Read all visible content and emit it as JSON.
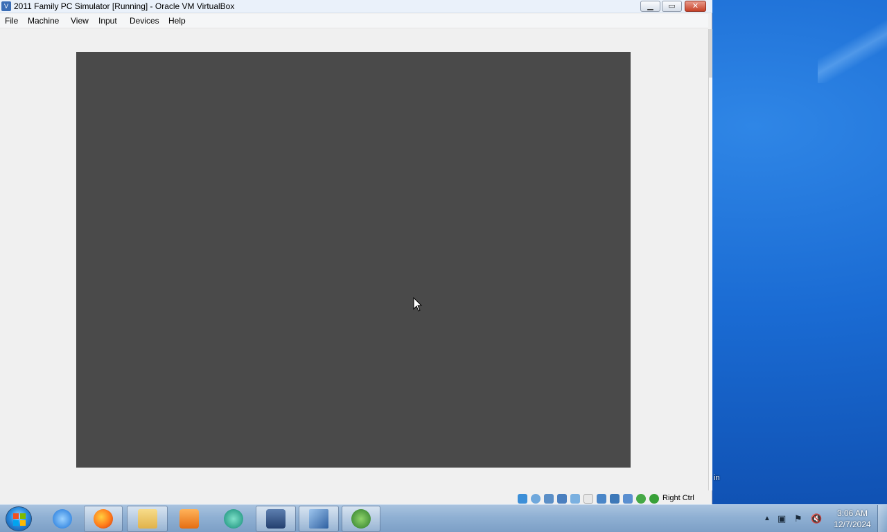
{
  "window": {
    "title": "2011 Family PC Simulator [Running] - Oracle VM VirtualBox",
    "controls": {
      "minimize": "▁",
      "maximize": "▭",
      "close": "✕"
    }
  },
  "menu": [
    "File",
    "Machine",
    "View",
    "Input",
    "Devices",
    "Help"
  ],
  "statusbar": {
    "host_key": "Right Ctrl"
  },
  "desktop": {
    "partial_label": "in"
  },
  "taskbar": {
    "items": [
      "Internet Explorer",
      "Firefox",
      "Windows Explorer",
      "Media Player",
      "App",
      "VirtualBox",
      "2008",
      "Download Manager"
    ],
    "tray_arrow": "▲",
    "clock_time": "3:06 AM",
    "clock_date": "12/7/2024"
  },
  "colors": {
    "vm_screen": "#4a4a4a",
    "window_bg": "#f0f0f0",
    "taskbar": "#8fb0d3"
  }
}
